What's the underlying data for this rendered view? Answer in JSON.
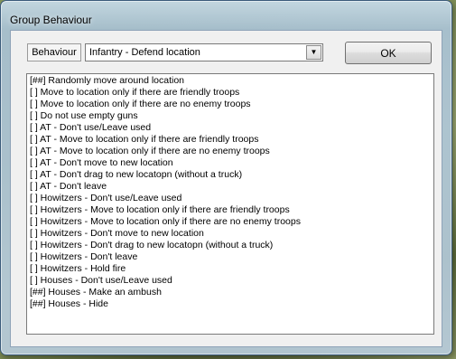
{
  "window": {
    "title": "Group Behaviour"
  },
  "toolbar": {
    "behaviour_label": "Behaviour",
    "behaviour_select": {
      "value": "Infantry - Defend location"
    },
    "ok_label": "OK"
  },
  "options": [
    "[##] Randomly move around location",
    "[  ] Move to location only if there are friendly troops",
    "[  ] Move to location only if there are no enemy troops",
    "[  ] Do not use empty guns",
    "[  ] AT - Don't use/Leave used",
    "[  ] AT - Move to location only if there are friendly troops",
    "[  ] AT - Move to location only if there are no enemy troops",
    "[  ] AT - Don't move to new location",
    "[  ] AT - Don't drag to new locatopn (without a truck)",
    "[  ] AT - Don't leave",
    "[  ] Howitzers - Don't use/Leave used",
    "[  ] Howitzers - Move to location only if there are friendly troops",
    "[  ] Howitzers - Move to location only if there are no enemy troops",
    "[  ] Howitzers - Don't move to new location",
    "[  ] Howitzers - Don't drag to new locatopn (without a truck)",
    "[  ] Howitzers - Don't leave",
    "[  ] Howitzers - Hold fire",
    "[  ] Houses - Don't use/Leave used",
    "[##] Houses - Make an ambush",
    "[##] Houses - Hide"
  ]
}
